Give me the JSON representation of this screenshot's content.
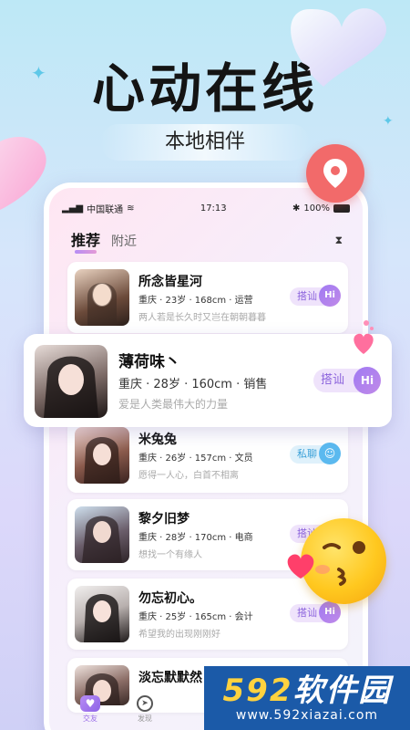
{
  "hero": {
    "title": "心动在线",
    "subtitle": "本地相伴"
  },
  "status_bar": {
    "carrier": "中国联通",
    "time": "17:13",
    "battery": "100%"
  },
  "tabs": {
    "recommend": "推荐",
    "nearby": "附近"
  },
  "cards": [
    {
      "name": "所念皆星河",
      "meta": "重庆 · 23岁 · 168cm · 运营",
      "bio": "两人若是长久时又岂在朝朝暮暮",
      "action": "搭讪",
      "badge": "Hi"
    },
    {
      "name": "米兔兔",
      "meta": "重庆 · 26岁 · 157cm · 文员",
      "bio": "愿得一人心，白首不相离",
      "action": "私聊",
      "badge": ""
    },
    {
      "name": "黎夕旧梦",
      "meta": "重庆 · 28岁 · 170cm · 电商",
      "bio": "想找一个有缘人",
      "action": "搭讪",
      "badge": "Hi"
    },
    {
      "name": "勿忘初心。",
      "meta": "重庆 · 25岁 · 165cm · 会计",
      "bio": "希望我的出现刚刚好",
      "action": "搭讪",
      "badge": "Hi"
    },
    {
      "name": "淡忘默默然",
      "meta": "",
      "bio": "",
      "action": "",
      "badge": ""
    }
  ],
  "featured": {
    "name": "薄荷味丶",
    "meta": "重庆 · 28岁 · 160cm · 销售",
    "bio": "爱是人类最伟大的力量",
    "action": "搭讪",
    "badge": "Hi"
  },
  "bottom_nav": {
    "friends": "交友",
    "discover": "发现"
  },
  "watermark": {
    "number": "592",
    "text": "软件园",
    "url": "www.592xiazai.com"
  },
  "colors": {
    "accent": "#9a6ce8",
    "location_bubble": "#f26a6a"
  }
}
